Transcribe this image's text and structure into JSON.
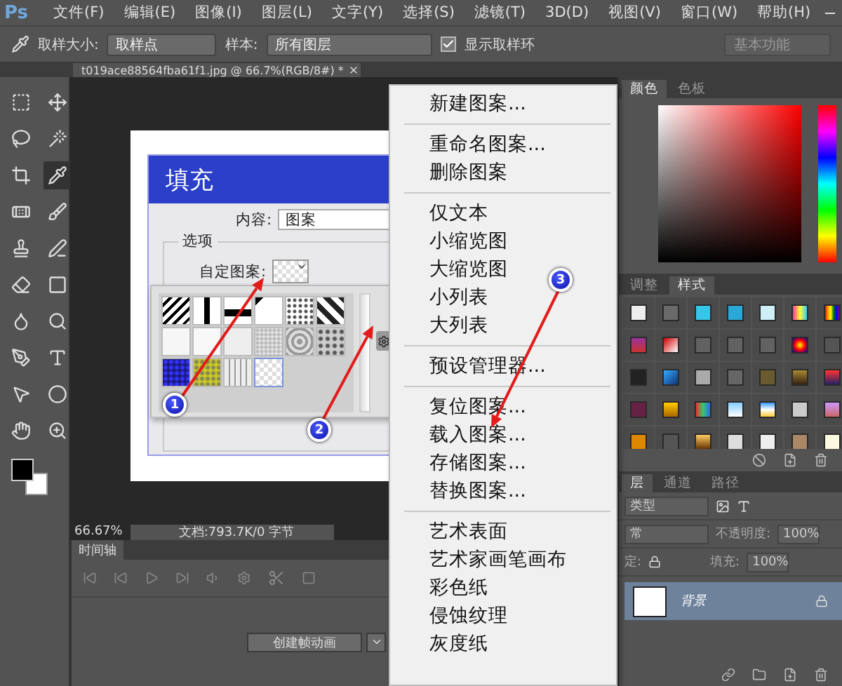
{
  "menubar": {
    "logo": "Ps",
    "items": [
      "文件(F)",
      "编辑(E)",
      "图像(I)",
      "图层(L)",
      "文字(Y)",
      "选择(S)",
      "滤镜(T)",
      "3D(D)",
      "视图(V)",
      "窗口(W)",
      "帮助(H)"
    ]
  },
  "options_bar": {
    "sample_size_label": "取样大小:",
    "sample_size": "取样点",
    "sample_label": "样本:",
    "sample": "所有图层",
    "show_ring": {
      "label": "显示取样环",
      "checked": true
    },
    "workspace": "基本功能"
  },
  "document_tab": {
    "title": "t019ace88564fba61f1.jpg @ 66.7%(RGB/8#) *"
  },
  "fill_dialog": {
    "title": "填充",
    "content_label": "内容:",
    "content_value": "图案",
    "options_label": "选项",
    "custom_pattern_label": "自定图案:"
  },
  "pattern_picker": {
    "swatches": [
      {
        "selected": false
      },
      {
        "selected": false
      },
      {
        "selected": false
      },
      {
        "selected": false
      },
      {
        "selected": false
      },
      {
        "selected": false
      },
      {
        "selected": false
      },
      {
        "selected": false
      },
      {
        "selected": false
      },
      {
        "selected": false
      },
      {
        "selected": false
      },
      {
        "selected": false
      },
      {
        "selected": false
      },
      {
        "selected": false
      },
      {
        "selected": false
      },
      {
        "selected": true
      }
    ]
  },
  "context_menu": {
    "groups": [
      [
        "新建图案..."
      ],
      [
        "重命名图案...",
        "删除图案"
      ],
      [
        "仅文本",
        "小缩览图",
        "大缩览图",
        "小列表",
        "大列表"
      ],
      [
        "预设管理器..."
      ],
      [
        "复位图案...",
        "载入图案...",
        "存储图案...",
        "替换图案..."
      ],
      [
        "艺术表面",
        "艺术家画笔画布",
        "彩色纸",
        "侵蚀纹理",
        "灰度纸"
      ]
    ]
  },
  "annotations": [
    "1",
    "2",
    "3"
  ],
  "status_bar": {
    "zoom": "66.67%",
    "doc_info": "文档:793.7K/0 字节"
  },
  "timeline": {
    "tab": "时间轴",
    "create_button": "创建帧动画"
  },
  "color_panel": {
    "tabs": [
      {
        "label": "颜色",
        "selected": true
      },
      {
        "label": "色板",
        "selected": false
      }
    ]
  },
  "styles_panel": {
    "tabs": [
      {
        "label": "调整",
        "selected": false
      },
      {
        "label": "样式",
        "selected": true
      }
    ]
  },
  "layers_panel": {
    "tabs": [
      {
        "label": "层",
        "selected": true
      },
      {
        "label": "通道",
        "selected": false
      },
      {
        "label": "路径",
        "selected": false
      }
    ],
    "filter": "类型",
    "blend_mode": "常",
    "opacity_label": "不透明度:",
    "opacity": "100%",
    "lock_label": "定:",
    "fill_label": "填充:",
    "fill": "100%",
    "layers": [
      {
        "name": "背景",
        "selected": true,
        "locked": true
      }
    ]
  }
}
